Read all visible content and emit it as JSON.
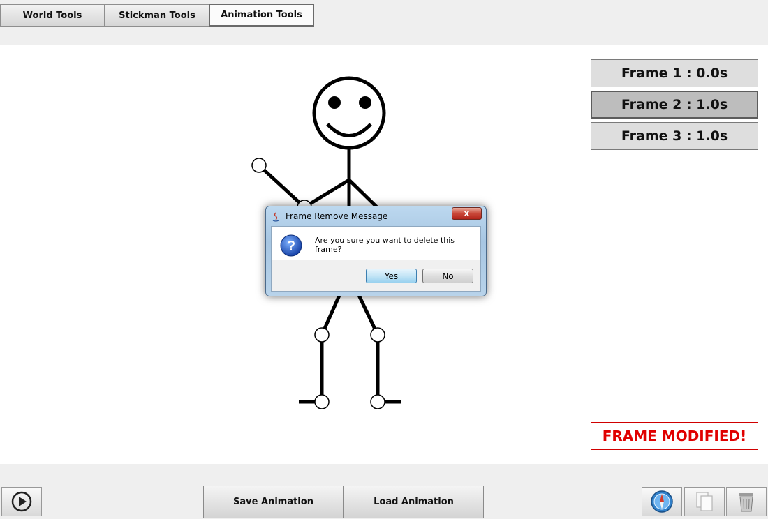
{
  "tabs": [
    {
      "label": "World Tools"
    },
    {
      "label": "Stickman Tools"
    },
    {
      "label": "Animation Tools",
      "active": true
    }
  ],
  "frames": [
    {
      "label": "Frame 1 : 0.0s"
    },
    {
      "label": "Frame 2 : 1.0s",
      "selected": true
    },
    {
      "label": "Frame 3 : 1.0s"
    }
  ],
  "status": {
    "modified_label": "FRAME MODIFIED!",
    "color": "#e00000"
  },
  "bottom": {
    "play_icon": "play-circle-icon",
    "save_label": "Save Animation",
    "load_label": "Load Animation",
    "right_icons": [
      "compass-icon",
      "copy-icon",
      "trash-icon"
    ]
  },
  "dialog": {
    "title": "Frame Remove Message",
    "message": "Are you sure you want to delete this frame?",
    "yes_label": "Yes",
    "no_label": "No",
    "close_label": "x",
    "icon": "question-icon"
  }
}
